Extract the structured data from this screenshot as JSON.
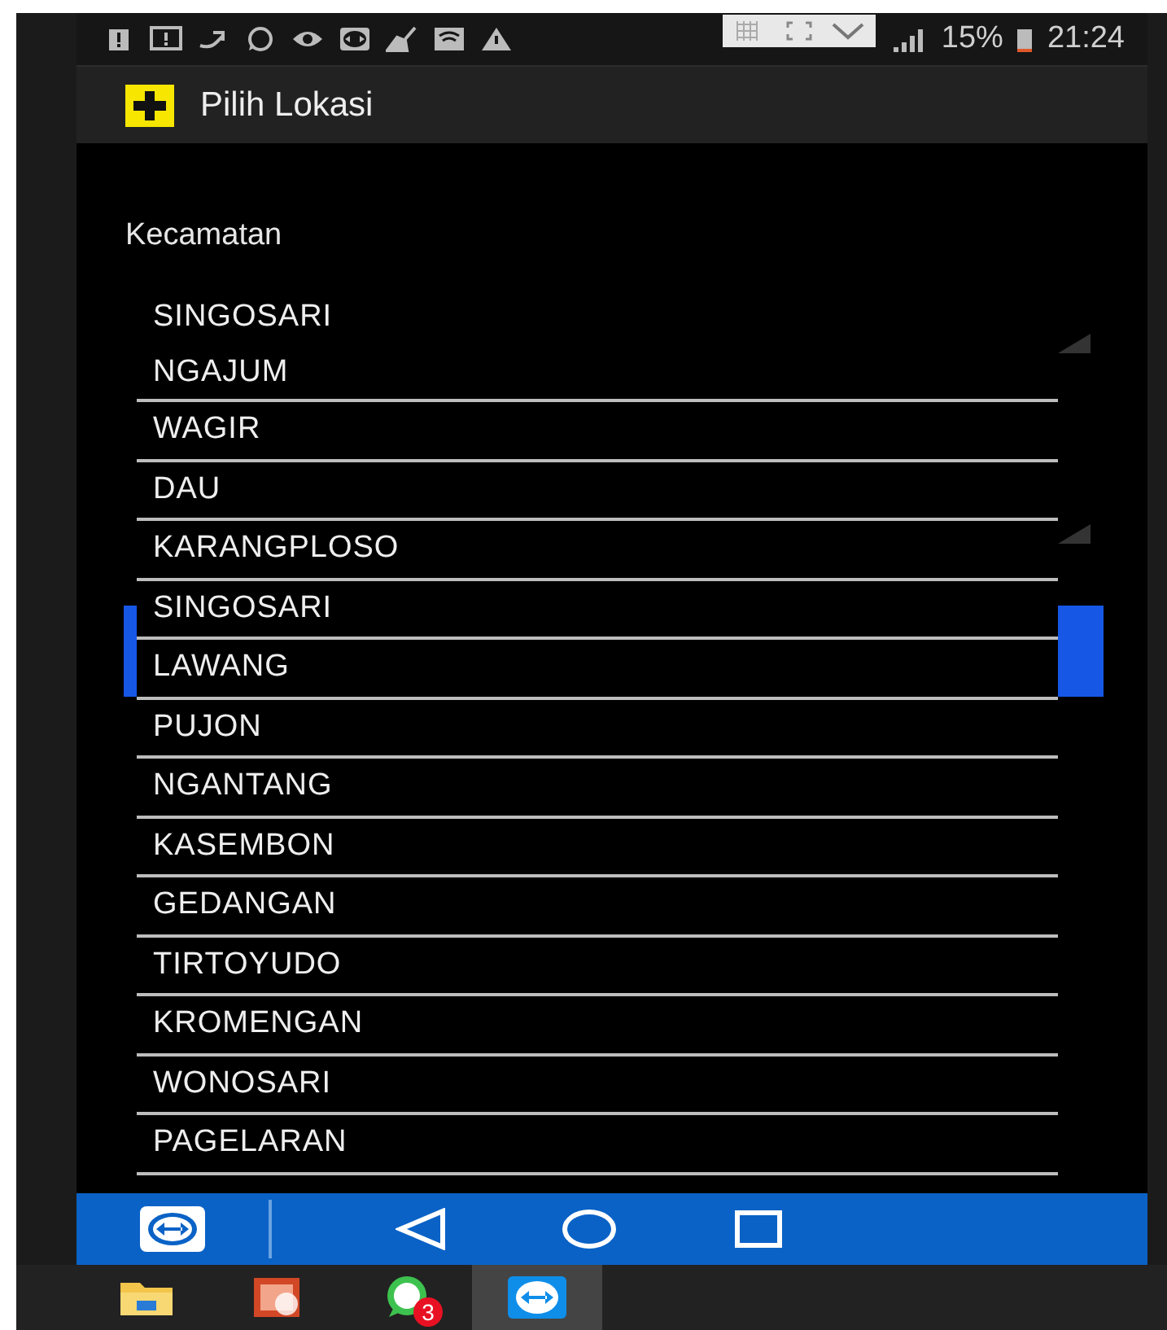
{
  "status_bar": {
    "battery": "15%",
    "time": "21:24"
  },
  "app_bar": {
    "title": "Pilih Lokasi"
  },
  "form": {
    "label": "Kecamatan",
    "value": "SINGOSARI"
  },
  "dropdown": {
    "items": [
      {
        "label": "NGAJUM"
      },
      {
        "label": "WAGIR"
      },
      {
        "label": "DAU"
      },
      {
        "label": "KARANGPLOSO"
      },
      {
        "label": "SINGOSARI"
      },
      {
        "label": "LAWANG"
      },
      {
        "label": "PUJON"
      },
      {
        "label": "NGANTANG"
      },
      {
        "label": "KASEMBON"
      },
      {
        "label": "GEDANGAN"
      },
      {
        "label": "TIRTOYUDO"
      },
      {
        "label": "KROMENGAN"
      },
      {
        "label": "WONOSARI"
      },
      {
        "label": "PAGELARAN"
      }
    ]
  },
  "taskbar": {
    "apps": [
      {
        "kind": "folder",
        "active": false
      },
      {
        "kind": "slides",
        "active": false
      },
      {
        "kind": "chat",
        "active": false,
        "badge": "3"
      },
      {
        "kind": "remote",
        "active": true
      }
    ]
  }
}
